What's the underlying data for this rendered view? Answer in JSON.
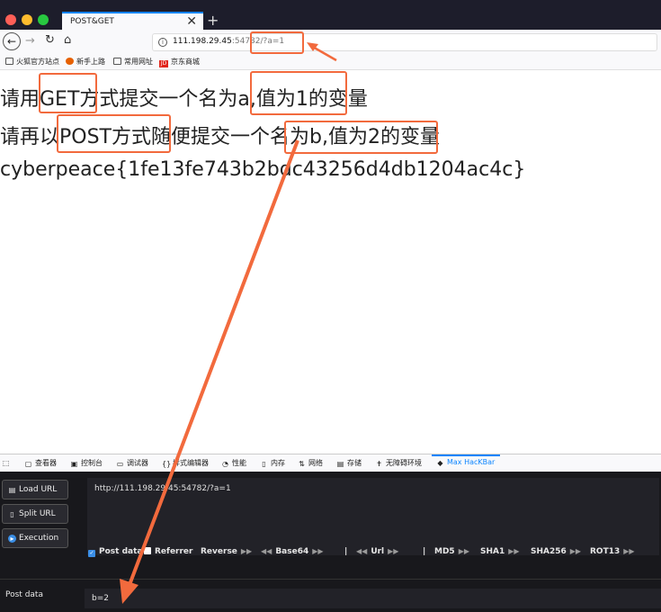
{
  "window": {
    "tab_title": "POST&GET",
    "tab_close": "✕",
    "new_tab": "+"
  },
  "toolbar": {
    "url_host": "111.198.29.45",
    "url_rest": ":54782/?a=1"
  },
  "bookmarks": [
    "火狐官方站点",
    "新手上路",
    "常用网址",
    "京东商城"
  ],
  "page": {
    "line1": "请用GET方式提交一个名为a,值为1的变量",
    "line2": "请再以POST方式随便提交一个名为b,值为2的变量",
    "line3": "cyberpeace{1fe13fe743b2bdc43256d4db1204ac4c}"
  },
  "devtools": {
    "tabs": [
      "查看器",
      "控制台",
      "调试器",
      "样式编辑器",
      "性能",
      "内存",
      "网络",
      "存储",
      "无障碍环境",
      "Max HacKBar"
    ]
  },
  "hackbar": {
    "buttons": [
      "Load URL",
      "Split URL",
      "Execution"
    ],
    "url_value": "http://111.198.29.45:54782/?a=1",
    "options": {
      "post_data": "Post data",
      "referrer": "Referrer",
      "reverse": "Reverse",
      "base64": "Base64",
      "sep": "|",
      "url": "Url",
      "md5": "MD5",
      "sha1": "SHA1",
      "sha256": "SHA256",
      "rot13": "ROT13"
    },
    "post_data_checked": true,
    "referrer_checked": false,
    "post_data_label": "Post data",
    "post_data_value": "b=2"
  },
  "colors": {
    "annotation": "#f26a3d",
    "active_tab": "#0a84ff"
  }
}
